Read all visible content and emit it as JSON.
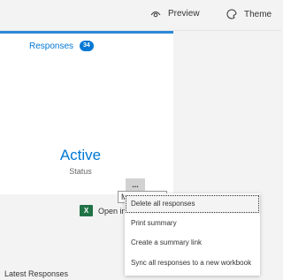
{
  "header": {
    "preview_label": "Preview",
    "theme_label": "Theme",
    "preview_icon": "eye-icon",
    "theme_icon": "palette-icon"
  },
  "panel": {
    "tab_label": "Responses",
    "response_count": "34",
    "status_value": "Active",
    "status_label": "Status"
  },
  "more_button": {
    "label": "..."
  },
  "tooltip": {
    "text": "M"
  },
  "open_excel": {
    "label": "Open in",
    "icon": "excel-icon",
    "icon_letter": "X"
  },
  "latest_responses": {
    "label": "Latest Responses"
  },
  "context_menu": {
    "items": [
      {
        "label": "Delete all responses"
      },
      {
        "label": "Print summary"
      },
      {
        "label": "Create a summary link"
      },
      {
        "label": "Sync all responses to a new workbook"
      }
    ]
  },
  "colors": {
    "accent": "#0078d4",
    "excel_green": "#217346"
  }
}
